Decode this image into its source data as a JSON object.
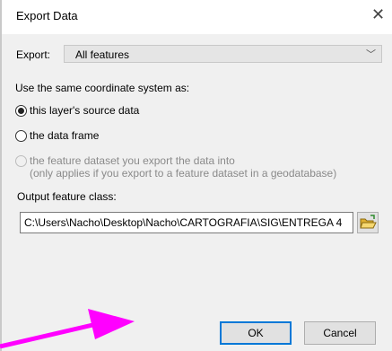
{
  "window": {
    "title": "Export Data",
    "close_icon": "close-icon"
  },
  "export": {
    "label": "Export:",
    "selected": "All features"
  },
  "coord_system": {
    "label": "Use the same coordinate system as:",
    "options": [
      {
        "label": "this layer's source data",
        "checked": true,
        "enabled": true
      },
      {
        "label": "the data frame",
        "checked": false,
        "enabled": true
      },
      {
        "label": "the feature dataset you export the data into",
        "sublabel": "(only applies if you export to a feature dataset in a geodatabase)",
        "checked": false,
        "enabled": false
      }
    ]
  },
  "output": {
    "label": "Output feature class:",
    "value": "C:\\Users\\Nacho\\Desktop\\Nacho\\CARTOGRAFIA\\SIG\\ENTREGA 4",
    "browse_icon": "open-folder-icon"
  },
  "buttons": {
    "ok": "OK",
    "cancel": "Cancel"
  },
  "colors": {
    "annotation_arrow": "#ff00ff",
    "dialog_bg": "#f0f0f0",
    "focus_border": "#0078d7"
  }
}
